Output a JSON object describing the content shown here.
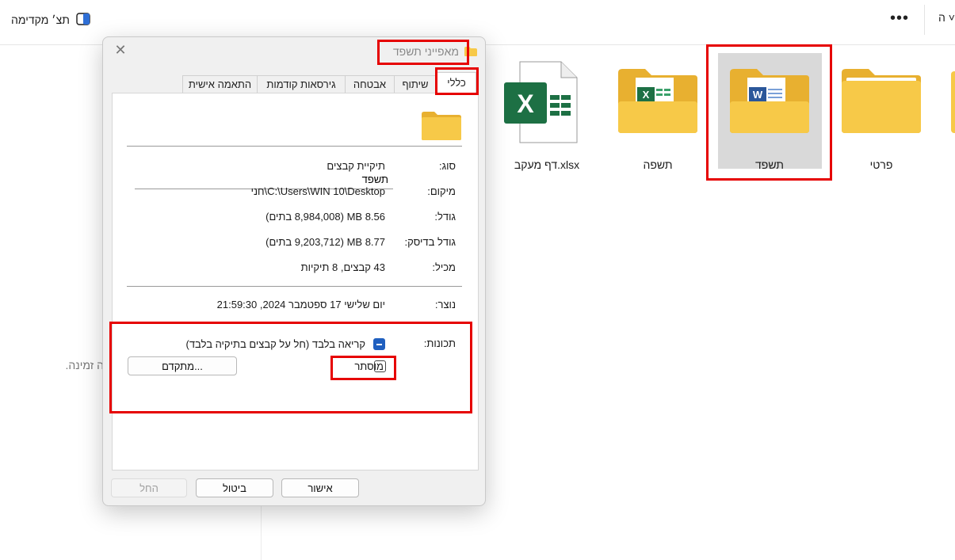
{
  "toolbar": {
    "preview_label": "תצ׳ מקדימה",
    "more_label": "•••",
    "sort_label": "ה ˅"
  },
  "nav_pane": {
    "empty_text": "ה זמינה."
  },
  "files": [
    {
      "name": "פרטי",
      "type": "folder"
    },
    {
      "name": "תשפד",
      "type": "folder-word",
      "selected": true
    },
    {
      "name": "תשפה",
      "type": "folder-excel"
    },
    {
      "name": "דף מעקב.xlsx",
      "type": "excel-file"
    }
  ],
  "dialog": {
    "title": "מאפייני תשפד",
    "tabs": [
      "כללי",
      "שיתוף",
      "אבטחה",
      "גירסאות קודמות",
      "התאמה אישית"
    ],
    "name_value": "תשפד",
    "rows": [
      {
        "label": "סוג:",
        "value": "תיקיית קבצים"
      },
      {
        "label": "מיקום:",
        "value": "C:\\Users\\WIN 10\\Desktop\\חני"
      },
      {
        "label": "גודל:",
        "value": "8.56 MB (8,984,008 בתים)"
      },
      {
        "label": "גודל בדיסק:",
        "value": "8.77 MB (9,203,712 בתים)"
      },
      {
        "label": "מכיל:",
        "value": "43 קבצים, 8 תיקיות"
      }
    ],
    "created": {
      "label": "נוצר:",
      "value": "יום שלישי 17 ספטמבר 2024, 21:59:30"
    },
    "attributes": {
      "label": "תכונות:",
      "readonly_label": "קריאה בלבד (חל על קבצים בתיקיה בלבד)",
      "hidden_label": "מוסתר",
      "advanced_label": "מתקדם..."
    },
    "buttons": {
      "ok": "אישור",
      "cancel": "ביטול",
      "apply": "החל"
    }
  },
  "colors": {
    "highlight": "#e60000",
    "folder": "#f7c948",
    "excel": "#1d7044",
    "word": "#2b579a"
  }
}
